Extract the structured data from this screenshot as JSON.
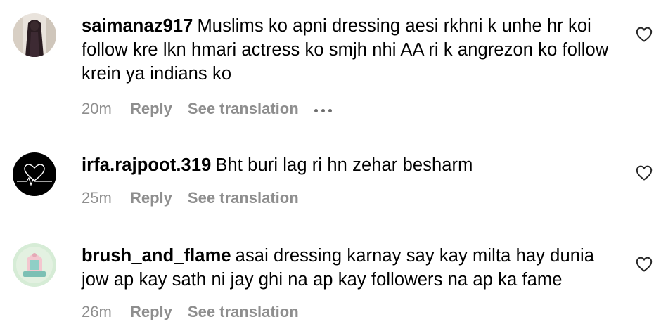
{
  "comments": [
    {
      "username": "saimanaz917",
      "text": "Muslims ko apni dressing aesi rkhni k unhe hr koi follow kre lkn hmari actress ko smjh nhi AA ri k angrezon ko follow krein ya indians ko",
      "time": "20m",
      "reply_label": "Reply",
      "translate_label": "See translation",
      "has_more_options": true
    },
    {
      "username": "irfa.rajpoot.319",
      "text": "Bht buri lag ri hn zehar besharm",
      "time": "25m",
      "reply_label": "Reply",
      "translate_label": "See translation",
      "has_more_options": false
    },
    {
      "username": "brush_and_flame",
      "text": "asai dressing karnay say kay milta hay dunia jow ap kay sath ni jay ghi na ap kay followers na ap ka fame",
      "time": "26m",
      "reply_label": "Reply",
      "translate_label": "See translation",
      "has_more_options": false
    }
  ],
  "icons": {
    "like": "heart-outline-icon",
    "more": "more-options-icon"
  },
  "colors": {
    "meta_text": "#8e8e8e",
    "primary_text": "#000000",
    "background": "#ffffff"
  }
}
